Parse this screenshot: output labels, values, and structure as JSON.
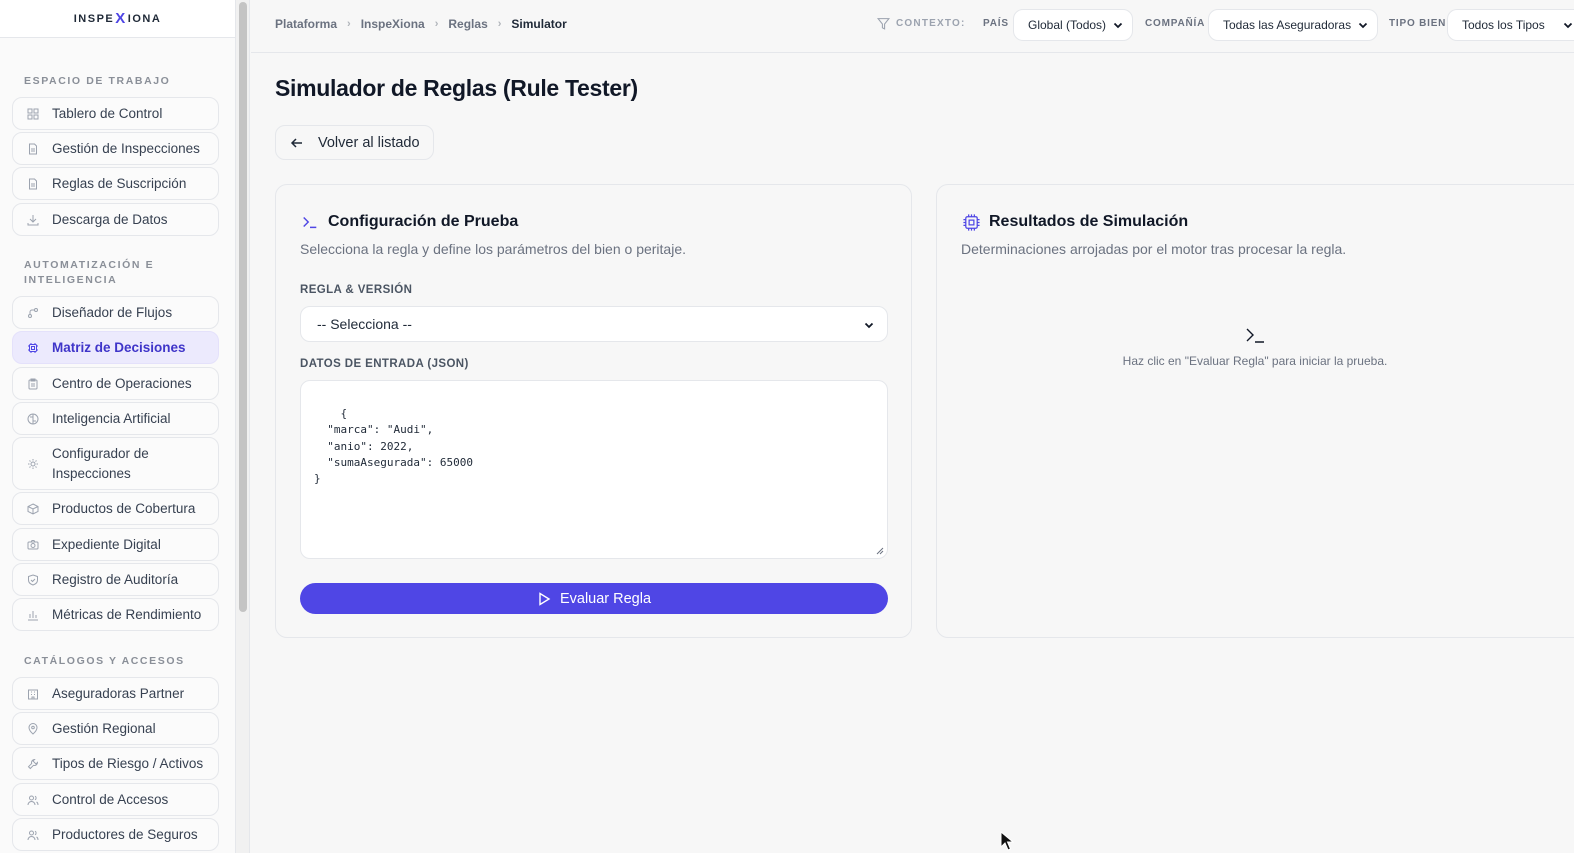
{
  "logo": {
    "left": "INSPE",
    "x": "X",
    "right": "IONA"
  },
  "sidebar": {
    "sections": [
      {
        "title": "ESPACIO DE TRABAJO"
      },
      {
        "title": "AUTOMATIZACIÓN E INTELIGENCIA"
      },
      {
        "title": "CATÁLOGOS Y ACCESOS"
      }
    ],
    "items": [
      {
        "label": "Tablero de Control",
        "icon": "grid-icon"
      },
      {
        "label": "Gestión de Inspecciones",
        "icon": "document-icon"
      },
      {
        "label": "Reglas de Suscripción",
        "icon": "document-icon"
      },
      {
        "label": "Descarga de Datos",
        "icon": "download-icon"
      },
      {
        "label": "Diseñador de Flujos",
        "icon": "flow-icon"
      },
      {
        "label": "Matriz de Decisiones",
        "icon": "chip-icon",
        "active": true
      },
      {
        "label": "Centro de Operaciones",
        "icon": "clipboard-icon"
      },
      {
        "label": "Inteligencia Artificial",
        "icon": "brain-icon"
      },
      {
        "label": "Configurador de Inspecciones",
        "icon": "gear-icon"
      },
      {
        "label": "Productos de Cobertura",
        "icon": "box-icon"
      },
      {
        "label": "Expediente Digital",
        "icon": "camera-icon"
      },
      {
        "label": "Registro de Auditoría",
        "icon": "shield-icon"
      },
      {
        "label": "Métricas de Rendimiento",
        "icon": "bar-chart-icon"
      },
      {
        "label": "Aseguradoras Partner",
        "icon": "building-icon"
      },
      {
        "label": "Gestión Regional",
        "icon": "map-pin-icon"
      },
      {
        "label": "Tipos de Riesgo / Activos",
        "icon": "wrench-icon"
      },
      {
        "label": "Control de Accesos",
        "icon": "users-icon"
      },
      {
        "label": "Productores de Seguros",
        "icon": "users-icon"
      }
    ]
  },
  "header": {
    "breadcrumb": [
      "Plataforma",
      "InspeXiona",
      "Reglas",
      "Simulator"
    ],
    "context_label": "CONTEXTO:",
    "filters": [
      {
        "label": "PAÍS",
        "value": "Global (Todos)"
      },
      {
        "label": "COMPAÑÍA",
        "value": "Todas las Aseguradoras"
      },
      {
        "label": "TIPO BIEN",
        "value": "Todos los Tipos"
      }
    ]
  },
  "main": {
    "title": "Simulador de Reglas (Rule Tester)",
    "back_label": "Volver al listado",
    "config": {
      "title": "Configuración de Prueba",
      "subtitle": "Selecciona la regla y define los parámetros del bien o peritaje.",
      "rule_label": "REGLA & VERSIÓN",
      "rule_value": "-- Selecciona --",
      "json_label": "DATOS DE ENTRADA (JSON)",
      "json_value": "{\n  \"marca\": \"Audi\",\n  \"anio\": 2022,\n  \"sumaAsegurada\": 65000\n}",
      "evaluate_label": "Evaluar Regla"
    },
    "results": {
      "title": "Resultados de Simulación",
      "subtitle": "Determinaciones arrojadas por el motor tras procesar la regla.",
      "empty_text": "Haz clic en \"Evaluar Regla\" para iniciar la prueba."
    }
  },
  "colors": {
    "accent": "#4f46e5",
    "active_bg": "#eceafd"
  }
}
